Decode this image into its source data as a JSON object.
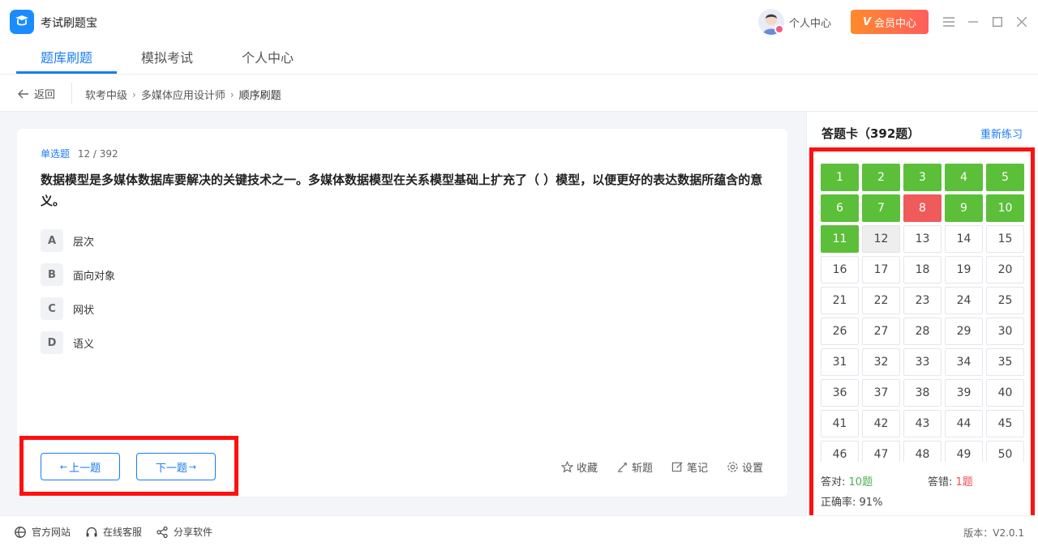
{
  "app": {
    "title": "考试刷题宝"
  },
  "header": {
    "personal_link": "个人中心",
    "vip_label": "会员中心",
    "vip_letter": "V"
  },
  "tabs": [
    {
      "label": "题库刷题",
      "active": true
    },
    {
      "label": "模拟考试",
      "active": false
    },
    {
      "label": "个人中心",
      "active": false
    }
  ],
  "breadcrumb": {
    "back_label": "返回",
    "items": [
      "软考中级",
      "多媒体应用设计师",
      "顺序刷题"
    ]
  },
  "question": {
    "type": "单选题",
    "progress": "12 / 392",
    "text": "数据模型是多媒体数据库要解决的关键技术之一。多媒体数据模型在关系模型基础上扩充了（ ）模型，以便更好的表达数据所蕴含的意义。",
    "options": [
      {
        "letter": "A",
        "text": "层次"
      },
      {
        "letter": "B",
        "text": "面向对象"
      },
      {
        "letter": "C",
        "text": "网状"
      },
      {
        "letter": "D",
        "text": "语义"
      }
    ]
  },
  "nav": {
    "prev_label": "上一题",
    "next_label": "下一题"
  },
  "tools": {
    "favorite": "收藏",
    "skip": "斩题",
    "note": "笔记",
    "settings": "设置"
  },
  "answer_card": {
    "title": "答题卡（392题）",
    "restart_label": "重新练习",
    "correct_label": "答对:",
    "correct_value": "10题",
    "wrong_label": "答错:",
    "wrong_value": "1题",
    "accuracy_label": "正确率:",
    "accuracy_value": "91%",
    "cells": [
      {
        "n": "1",
        "s": "correct"
      },
      {
        "n": "2",
        "s": "correct"
      },
      {
        "n": "3",
        "s": "correct"
      },
      {
        "n": "4",
        "s": "correct"
      },
      {
        "n": "5",
        "s": "correct"
      },
      {
        "n": "6",
        "s": "correct"
      },
      {
        "n": "7",
        "s": "correct"
      },
      {
        "n": "8",
        "s": "wrong"
      },
      {
        "n": "9",
        "s": "correct"
      },
      {
        "n": "10",
        "s": "correct"
      },
      {
        "n": "11",
        "s": "correct"
      },
      {
        "n": "12",
        "s": "current"
      },
      {
        "n": "13",
        "s": "none"
      },
      {
        "n": "14",
        "s": "none"
      },
      {
        "n": "15",
        "s": "none"
      },
      {
        "n": "16",
        "s": "none"
      },
      {
        "n": "17",
        "s": "none"
      },
      {
        "n": "18",
        "s": "none"
      },
      {
        "n": "19",
        "s": "none"
      },
      {
        "n": "20",
        "s": "none"
      },
      {
        "n": "21",
        "s": "none"
      },
      {
        "n": "22",
        "s": "none"
      },
      {
        "n": "23",
        "s": "none"
      },
      {
        "n": "24",
        "s": "none"
      },
      {
        "n": "25",
        "s": "none"
      },
      {
        "n": "26",
        "s": "none"
      },
      {
        "n": "27",
        "s": "none"
      },
      {
        "n": "28",
        "s": "none"
      },
      {
        "n": "29",
        "s": "none"
      },
      {
        "n": "30",
        "s": "none"
      },
      {
        "n": "31",
        "s": "none"
      },
      {
        "n": "32",
        "s": "none"
      },
      {
        "n": "33",
        "s": "none"
      },
      {
        "n": "34",
        "s": "none"
      },
      {
        "n": "35",
        "s": "none"
      },
      {
        "n": "36",
        "s": "none"
      },
      {
        "n": "37",
        "s": "none"
      },
      {
        "n": "38",
        "s": "none"
      },
      {
        "n": "39",
        "s": "none"
      },
      {
        "n": "40",
        "s": "none"
      },
      {
        "n": "41",
        "s": "none"
      },
      {
        "n": "42",
        "s": "none"
      },
      {
        "n": "43",
        "s": "none"
      },
      {
        "n": "44",
        "s": "none"
      },
      {
        "n": "45",
        "s": "none"
      },
      {
        "n": "46",
        "s": "none"
      },
      {
        "n": "47",
        "s": "none"
      },
      {
        "n": "48",
        "s": "none"
      },
      {
        "n": "49",
        "s": "none"
      },
      {
        "n": "50",
        "s": "none"
      }
    ]
  },
  "footer": {
    "website": "官方网站",
    "support": "在线客服",
    "share": "分享软件",
    "version": "版本：V2.0.1"
  },
  "colors": {
    "accent": "#1a7cf5",
    "correct": "#5bbf3a",
    "wrong": "#ef5b5b",
    "annotation": "#ff1010"
  }
}
